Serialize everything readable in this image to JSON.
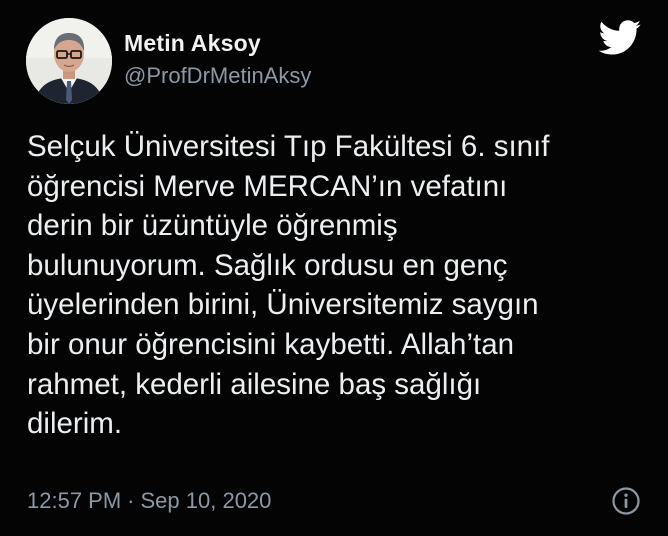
{
  "author": {
    "display_name": "Metin Aksoy",
    "handle": "@ProfDrMetinAksy",
    "avatar_icon": "profile-photo"
  },
  "brand_icon": "twitter-bird-icon",
  "tweet": {
    "lines": [
      "Selçuk Üniversitesi Tıp Fakültesi 6. sınıf",
      "öğrencisi Merve MERCAN’ın vefatını",
      "derin bir üzüntüyle öğrenmiş",
      "bulunuyorum. Sağlık ordusu en genç",
      "üyelerinden birini, Üniversitemiz saygın",
      "bir onur öğrencisini kaybetti. Allah’tan",
      "rahmet, kederli ailesine baş sağlığı",
      "dilerim."
    ]
  },
  "meta": {
    "time": "12:57 PM",
    "separator": "·",
    "date": "Sep 10, 2020",
    "info_icon": "info-icon"
  },
  "colors": {
    "background": "#040404",
    "text": "#eceff1",
    "secondary": "#8b98a5"
  }
}
